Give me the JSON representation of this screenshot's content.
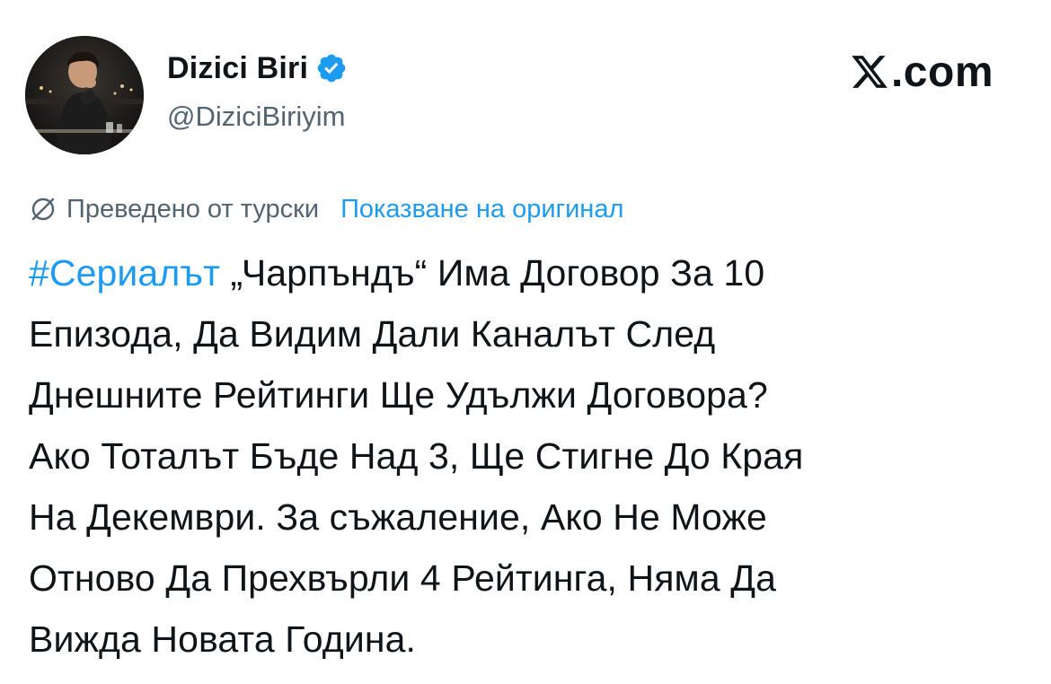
{
  "author": {
    "display_name": "Dizici Biri",
    "handle": "@DiziciBiriyim",
    "verified": true,
    "avatar_icon": "profile-photo"
  },
  "brand": {
    "icon": "x-logo-icon",
    "domain": ".com"
  },
  "translation": {
    "icon": "globe-icon",
    "note": "Преведено от турски",
    "show_original": "Показване на оригинал"
  },
  "tweet": {
    "hashtag": "#Сериалът",
    "line_1_rest": " „Чарпъндъ“ Има Договор За 10",
    "lines": [
      "Епизода, Да Видим Дали Каналът След",
      "Днешните Рейтинги Ще Удължи Договора?",
      "Ако Тоталът Бъде Над 3, Ще Стигне До Края",
      "На Декември. За съжаление, Ако Не Може",
      "Отново Да Прехвърли 4 Рейтинга, Няма Да",
      "Вижда Новата Година."
    ]
  },
  "colors": {
    "text": "#0f1419",
    "secondary": "#536471",
    "link": "#1d9bf0",
    "verified": "#1d9bf0"
  }
}
